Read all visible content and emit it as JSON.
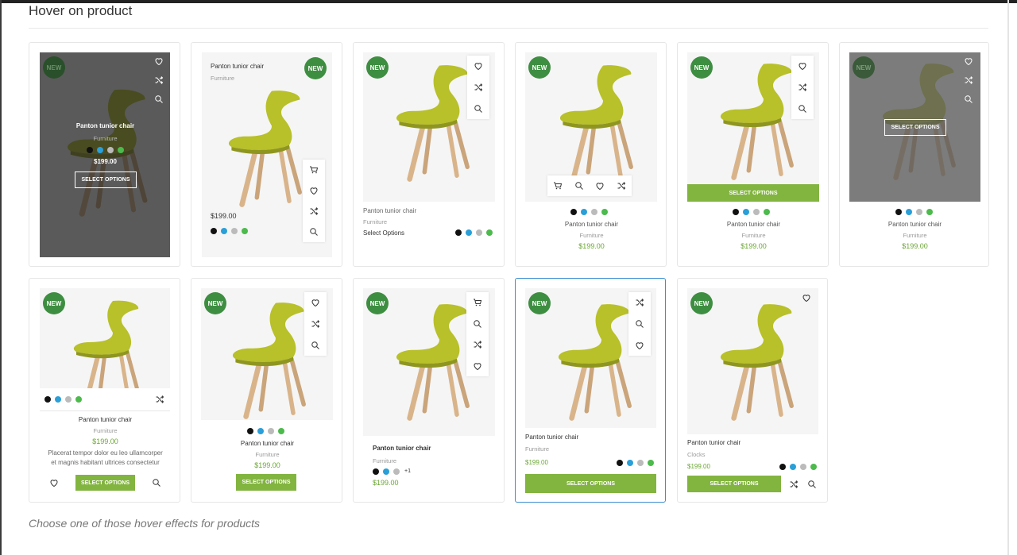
{
  "page": {
    "heading": "Hover on product",
    "footer_note": "Choose one of those hover effects for products"
  },
  "product": {
    "title": "Panton tunior chair",
    "category": "Furniture",
    "category_alt": "Clocks",
    "price": "$199.00",
    "badge": "NEW",
    "select_options_caps": "SELECT OPTIONS",
    "select_options": "Select Options",
    "description": "Placerat tempor dolor eu leo ullamcorper et magnis habitant ultrices consectetur",
    "more_colors": "+1"
  },
  "colors": {
    "swatches": [
      "#111111",
      "#2a9fd8",
      "#bbbbbb",
      "#4cba4c"
    ],
    "accent": "#82b440",
    "badge": "#3e8e41",
    "price": "#6aa632",
    "chair_seat": "#b8c02a",
    "chair_legs": "#d9b48a",
    "overlay": "#222222"
  },
  "icons": [
    "heart-icon",
    "shuffle-icon",
    "search-icon",
    "cart-icon"
  ]
}
